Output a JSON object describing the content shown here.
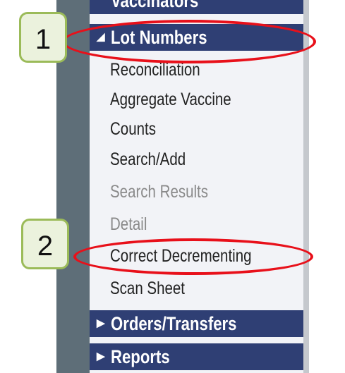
{
  "menu": {
    "cut_header_label": "Vaccinators",
    "lot_numbers": {
      "label": "Lot Numbers",
      "items": [
        {
          "label": "Reconciliation",
          "enabled": true
        },
        {
          "label": "Aggregate Vaccine",
          "enabled": true
        },
        {
          "label": "Counts",
          "enabled": true
        },
        {
          "label": "Search/Add",
          "enabled": true
        },
        {
          "label": "Search Results",
          "enabled": false
        },
        {
          "label": "Detail",
          "enabled": false
        },
        {
          "label": "Correct Decrementing",
          "enabled": true
        },
        {
          "label": "Scan Sheet",
          "enabled": true
        }
      ]
    },
    "orders_transfers": {
      "label": "Orders/Transfers"
    },
    "reports": {
      "label": "Reports"
    }
  },
  "callouts": {
    "one": "1",
    "two": "2"
  },
  "icons": {
    "expanded": "triangle-down-left-icon",
    "collapsed": "triangle-right-icon"
  },
  "colors": {
    "header_bg": "#2f3f74",
    "menu_bg": "#f2f3f7",
    "disabled_text": "#8a8a8a",
    "callout_border": "#9bbb59",
    "callout_fill": "#ebf2dd",
    "highlight_ellipse": "#e8101a"
  }
}
